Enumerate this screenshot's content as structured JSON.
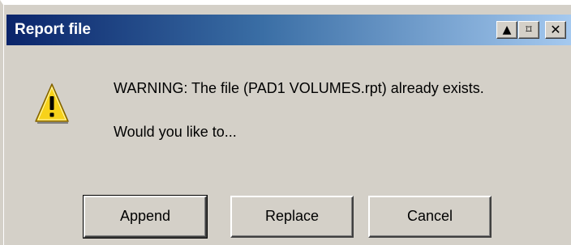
{
  "window": {
    "title": "Report file",
    "buttons": {
      "up_glyph": "▲",
      "pin_glyph": "⌑",
      "close_glyph": "✕"
    }
  },
  "message": {
    "icon": "warning-icon",
    "warning": "WARNING: The file (PAD1 VOLUMES.rpt) already exists.",
    "question": "Would you like to..."
  },
  "actions": {
    "append_label": "Append",
    "replace_label": "Replace",
    "cancel_label": "Cancel"
  },
  "colors": {
    "titlebar_start": "#0a246a",
    "titlebar_end": "#a6caf0",
    "dialog_face": "#d4d0c8",
    "warning_yellow": "#f7d21a"
  }
}
